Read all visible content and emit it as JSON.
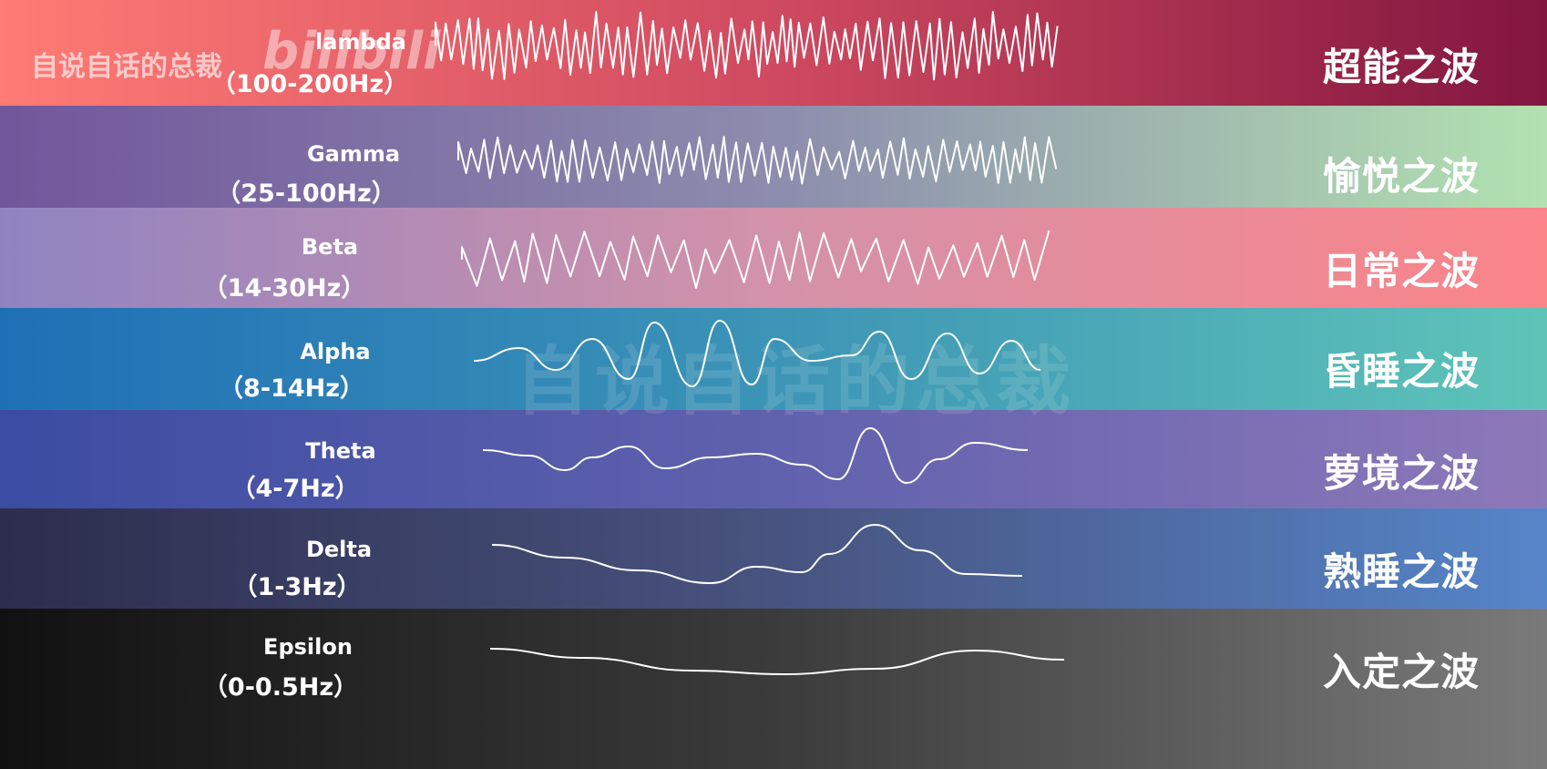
{
  "watermark": {
    "channel": "自说自话的总裁",
    "logo": "bilibili",
    "center": "自说自话的总裁"
  },
  "bands": [
    {
      "id": "lambda",
      "name": "lambda",
      "range": "（100-200Hz）",
      "label_cn": "超能之波",
      "colors": [
        "#ff7b74",
        "#cf4a60",
        "#82163f"
      ],
      "wave": "lambda"
    },
    {
      "id": "gamma",
      "name": "Gamma",
      "range": "（25-100Hz）",
      "label_cn": "愉悦之波",
      "colors": [
        "#72569c",
        "#8c8cad",
        "#b2e2b0"
      ],
      "wave": "gamma"
    },
    {
      "id": "beta",
      "name": "Beta",
      "range": "（14-30Hz）",
      "label_cn": "日常之波",
      "colors": [
        "#8f84c1",
        "#d392a9",
        "#fb8489"
      ],
      "wave": "beta"
    },
    {
      "id": "alpha",
      "name": "Alpha",
      "range": "（8-14Hz）",
      "label_cn": "昏睡之波",
      "colors": [
        "#1f6fb6",
        "#3c94b6",
        "#5ec4b8"
      ],
      "wave": "alpha"
    },
    {
      "id": "theta",
      "name": "Theta",
      "range": "（4-7Hz）",
      "label_cn": "萝境之波",
      "colors": [
        "#3b4ca2",
        "#6061ad",
        "#8d78b9"
      ],
      "wave": "theta"
    },
    {
      "id": "delta",
      "name": "Delta",
      "range": "（1-3Hz）",
      "label_cn": "熟睡之波",
      "colors": [
        "#2d2d4d",
        "#48537f",
        "#5585c9"
      ],
      "wave": "delta"
    },
    {
      "id": "epsilon",
      "name": "Epsilon",
      "range": "（0-0.5Hz）",
      "label_cn": "入定之波",
      "colors": [
        "#111111",
        "#3b3b3b",
        "#7a7a7a"
      ],
      "wave": "epsilon"
    }
  ]
}
